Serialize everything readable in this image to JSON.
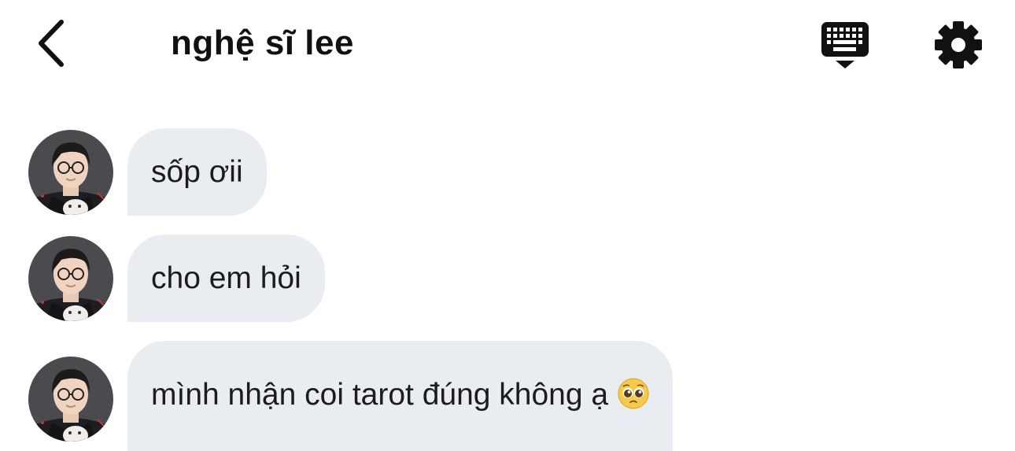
{
  "header": {
    "title": "nghệ sĩ lee",
    "back_icon": "chevron-left-icon",
    "keyboard_icon": "keyboard-icon",
    "settings_icon": "gear-icon"
  },
  "messages": [
    {
      "text": "sốp ơii"
    },
    {
      "text": "cho em hỏi"
    },
    {
      "text": "mình nhận coi tarot đúng không ạ",
      "emoji": "pleading-face-emoji"
    }
  ],
  "colors": {
    "bubble": "#e9ecf0",
    "text": "#111111",
    "background": "#ffffff"
  }
}
